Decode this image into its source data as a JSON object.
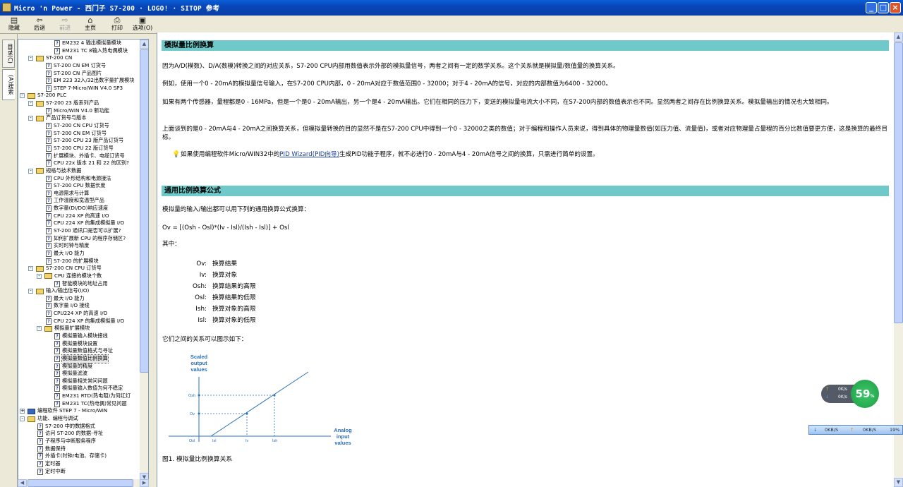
{
  "window": {
    "title": "Micro 'n Power - 西门子 S7-200 · LOGO! · SITOP 参考",
    "buttons": {
      "minimize": "_",
      "maximize": "□",
      "close": "×"
    }
  },
  "toolbar": {
    "buttons": [
      {
        "label": "隐藏",
        "icon": "hide-icon"
      },
      {
        "label": "后退",
        "icon": "back-icon"
      },
      {
        "label": "前进",
        "icon": "forward-icon"
      },
      {
        "label": "主页",
        "icon": "home-icon"
      },
      {
        "label": "打印",
        "icon": "print-icon"
      },
      {
        "label": "选项(O)",
        "icon": "options-icon"
      }
    ]
  },
  "side_tabs": [
    {
      "label": "目录(C)",
      "active": false
    },
    {
      "label": "(A)搜索",
      "active": true
    }
  ],
  "tree": [
    {
      "d": 3,
      "t": "p",
      "label": "EM232 4 输出模拟量模块"
    },
    {
      "d": 3,
      "t": "p",
      "label": "EM231 TC 8输入热电偶模块"
    },
    {
      "d": 1,
      "t": "b",
      "e": "-",
      "label": "ST-200 CN"
    },
    {
      "d": 2,
      "t": "p",
      "label": "ST-200 CN EM 订货号"
    },
    {
      "d": 2,
      "t": "p",
      "label": "ST-200 CN 产品图片"
    },
    {
      "d": 2,
      "t": "p",
      "label": "EM 223 32入/32出数字量扩展模块"
    },
    {
      "d": 2,
      "t": "p",
      "label": "STEP 7-Micro/WIN V4.0 SP3"
    },
    {
      "d": 0,
      "t": "b",
      "e": "-",
      "label": "S7-200 PLC"
    },
    {
      "d": 1,
      "t": "b",
      "e": "-",
      "label": "S7-200 23 版系列产品"
    },
    {
      "d": 2,
      "t": "p",
      "label": "Micro/WIN V4.0 新功能"
    },
    {
      "d": 1,
      "t": "b",
      "e": "-",
      "label": "产品订货号与版本"
    },
    {
      "d": 2,
      "t": "p",
      "label": "S7-200 CN CPU 订货号"
    },
    {
      "d": 2,
      "t": "p",
      "label": "S7-200 CN EM 订货号"
    },
    {
      "d": 2,
      "t": "p",
      "label": "S7-200 CPU 23 版产品订货号"
    },
    {
      "d": 2,
      "t": "p",
      "label": "S7-200 CPU 22 版订货号"
    },
    {
      "d": 2,
      "t": "p",
      "label": "扩展模块、外插卡、电缆订货号"
    },
    {
      "d": 2,
      "t": "p",
      "label": "CPU 22x 版本 21 和 22 的区别?"
    },
    {
      "d": 1,
      "t": "b",
      "e": "-",
      "label": "规格与技术数据"
    },
    {
      "d": 2,
      "t": "p",
      "label": "CPU 外形结构和电源接法"
    },
    {
      "d": 2,
      "t": "p",
      "label": "S7-200 CPU 数据长度"
    },
    {
      "d": 2,
      "t": "p",
      "label": "电源需求与计算"
    },
    {
      "d": 2,
      "t": "p",
      "label": "工作温度和宽温型产品"
    },
    {
      "d": 2,
      "t": "p",
      "label": "数字量(DI/DO)响应速度"
    },
    {
      "d": 2,
      "t": "p",
      "label": "CPU 224 XP 的高速 I/O"
    },
    {
      "d": 2,
      "t": "p",
      "label": "CPU 224 XP 的集成模拟量 I/O"
    },
    {
      "d": 2,
      "t": "p",
      "label": "ST-200 通讯口是否可以扩展?"
    },
    {
      "d": 2,
      "t": "p",
      "label": "如何扩展新 CPU 的程序存储区?"
    },
    {
      "d": 2,
      "t": "p",
      "label": "实时时钟与精度"
    },
    {
      "d": 2,
      "t": "p",
      "label": "最大 I/O 能力"
    },
    {
      "d": 2,
      "t": "p",
      "label": "S7-200 的扩展模块"
    },
    {
      "d": 1,
      "t": "b",
      "e": "-",
      "label": "S7-200 CN CPU 订货号"
    },
    {
      "d": 2,
      "t": "b",
      "e": "-",
      "label": "CPU 连接的模块个数"
    },
    {
      "d": 3,
      "t": "p",
      "label": "智能模块的地址占用"
    },
    {
      "d": 1,
      "t": "b",
      "e": "-",
      "label": "输入/输出信号(I/O)"
    },
    {
      "d": 2,
      "t": "p",
      "label": "最大 I/O 能力"
    },
    {
      "d": 2,
      "t": "p",
      "label": "数字量 I/O 接线"
    },
    {
      "d": 2,
      "t": "p",
      "label": "CPU224 XP 的高速 I/O"
    },
    {
      "d": 2,
      "t": "p",
      "label": "CPU 224 XP 的集成模拟量 I/O"
    },
    {
      "d": 2,
      "t": "b",
      "e": "-",
      "label": "模拟量扩展模块"
    },
    {
      "d": 3,
      "t": "p",
      "label": "模拟量输入模块接线"
    },
    {
      "d": 3,
      "t": "p",
      "label": "模拟量模块设置"
    },
    {
      "d": 3,
      "t": "p",
      "label": "模拟量数值格式与寻址"
    },
    {
      "d": 3,
      "t": "p",
      "label": "模拟量数值比例换算",
      "sel": true
    },
    {
      "d": 3,
      "t": "p",
      "label": "模拟量的精度"
    },
    {
      "d": 3,
      "t": "p",
      "label": "模拟量滤波"
    },
    {
      "d": 3,
      "t": "p",
      "label": "模拟量相关常问问题"
    },
    {
      "d": 3,
      "t": "p",
      "label": "模拟量输入数值为何不稳定"
    },
    {
      "d": 3,
      "t": "p",
      "label": "EM231 RTD(热电阻)为何红灯"
    },
    {
      "d": 3,
      "t": "p",
      "label": "EM231 TC(热电偶)常见问题"
    },
    {
      "d": 0,
      "t": "b",
      "e": "+",
      "label": "编程软件 STEP 7 - Micro/WIN"
    },
    {
      "d": 0,
      "t": "b",
      "e": "-",
      "label": "功能、编程与调试"
    },
    {
      "d": 1,
      "t": "p",
      "label": "S7-200 中的数据格式"
    },
    {
      "d": 1,
      "t": "p",
      "label": "访问 ST-200 的数据-寻址"
    },
    {
      "d": 1,
      "t": "p",
      "label": "子程序与中断服务程序"
    },
    {
      "d": 1,
      "t": "p",
      "label": "数据保持"
    },
    {
      "d": 1,
      "t": "p",
      "label": "外插卡(时钟/电池、存储卡)"
    },
    {
      "d": 1,
      "t": "p",
      "label": "定时器"
    },
    {
      "d": 1,
      "t": "p",
      "label": "定时中断"
    }
  ],
  "content": {
    "section1_title": "模拟量比例换算",
    "p1": "因为A/D(模数)、D/A(数模)转换之间的对应关系，S7-200 CPU内部用数值表示外部的模拟量信号，两者之间有一定的数学关系。这个关系就是模拟量/数值量的换算关系。",
    "p2": "例如，使用一个0 - 20mA的模拟量信号输入，在S7-200 CPU内部，0 - 20mA对应于数值范围0 - 32000；对于4 - 20mA的信号，对应的内部数值为6400 - 32000。",
    "p3": "如果有两个传感器，量程都是0 - 16MPa，但是一个是0 - 20mA输出，另一个是4 - 20mA输出。它们在相同的压力下，变送的模拟量电流大小不同，在S7-200内部的数值表示也不同。显然两者之间存在比例换算关系。模拟量输出的情况也大致相同。",
    "p4": "上面谈到的是0 - 20mA与4 - 20mA之间换算关系，但模拟量转换的目的显然不是在S7-200 CPU中得到一个0 - 32000之类的数值；对于编程和操作人员来说，得到具体的物理量数值(如压力值、流量值)，或者对应物理量占量程的百分比数值要更方便，这是换算的最终目标。",
    "tip_before": "如果使用编程软件Micro/WIN32中的",
    "tip_link": "PID Wizard(PID向导)",
    "tip_after": "生成PID功能子程序，就不必进行0 - 20mA与4 - 20mA信号之间的换算，只需进行简单的设置。",
    "section2_title": "通用比例换算公式",
    "p5": "模拟量的输入/输出都可以用下列的通用换算公式换算：",
    "formula": "Ov = [(Osh - Osl)*(Iv - Isl)/(Ish - Isl)] + Osl",
    "where": "其中：",
    "variables": [
      {
        "name": "Ov:",
        "desc": "换算结果"
      },
      {
        "name": "Iv:",
        "desc": "换算对象"
      },
      {
        "name": "Osh:",
        "desc": "换算结果的高限"
      },
      {
        "name": "Osl:",
        "desc": "换算结果的低限"
      },
      {
        "name": "Ish:",
        "desc": "换算对象的高限"
      },
      {
        "name": "Isl:",
        "desc": "换算对象的低限"
      }
    ],
    "relation_text": "它们之间的关系可以图示如下：",
    "figure": {
      "y_title": [
        "Scaled",
        "output",
        "values"
      ],
      "x_title": [
        "Analog",
        "input",
        "values"
      ],
      "y_ticks": [
        "Osh",
        "Ov",
        "Osl"
      ],
      "x_ticks": [
        "Isl",
        "Iv",
        "Ish"
      ],
      "caption": "图1. 模拟量比例换算关系",
      "line_color": "#2a6fb8"
    }
  },
  "net_widget": {
    "up": "0K/s",
    "down": "0K/s",
    "percent": "59",
    "percent_unit": "%"
  },
  "speed_bar": {
    "down": "0KB/S",
    "up": "0KB/S",
    "cpu": "19%"
  },
  "colors": {
    "heading_bg": "#6fc9c9",
    "title_bar": "#0a5fd8",
    "link": "#1a3fa0"
  }
}
